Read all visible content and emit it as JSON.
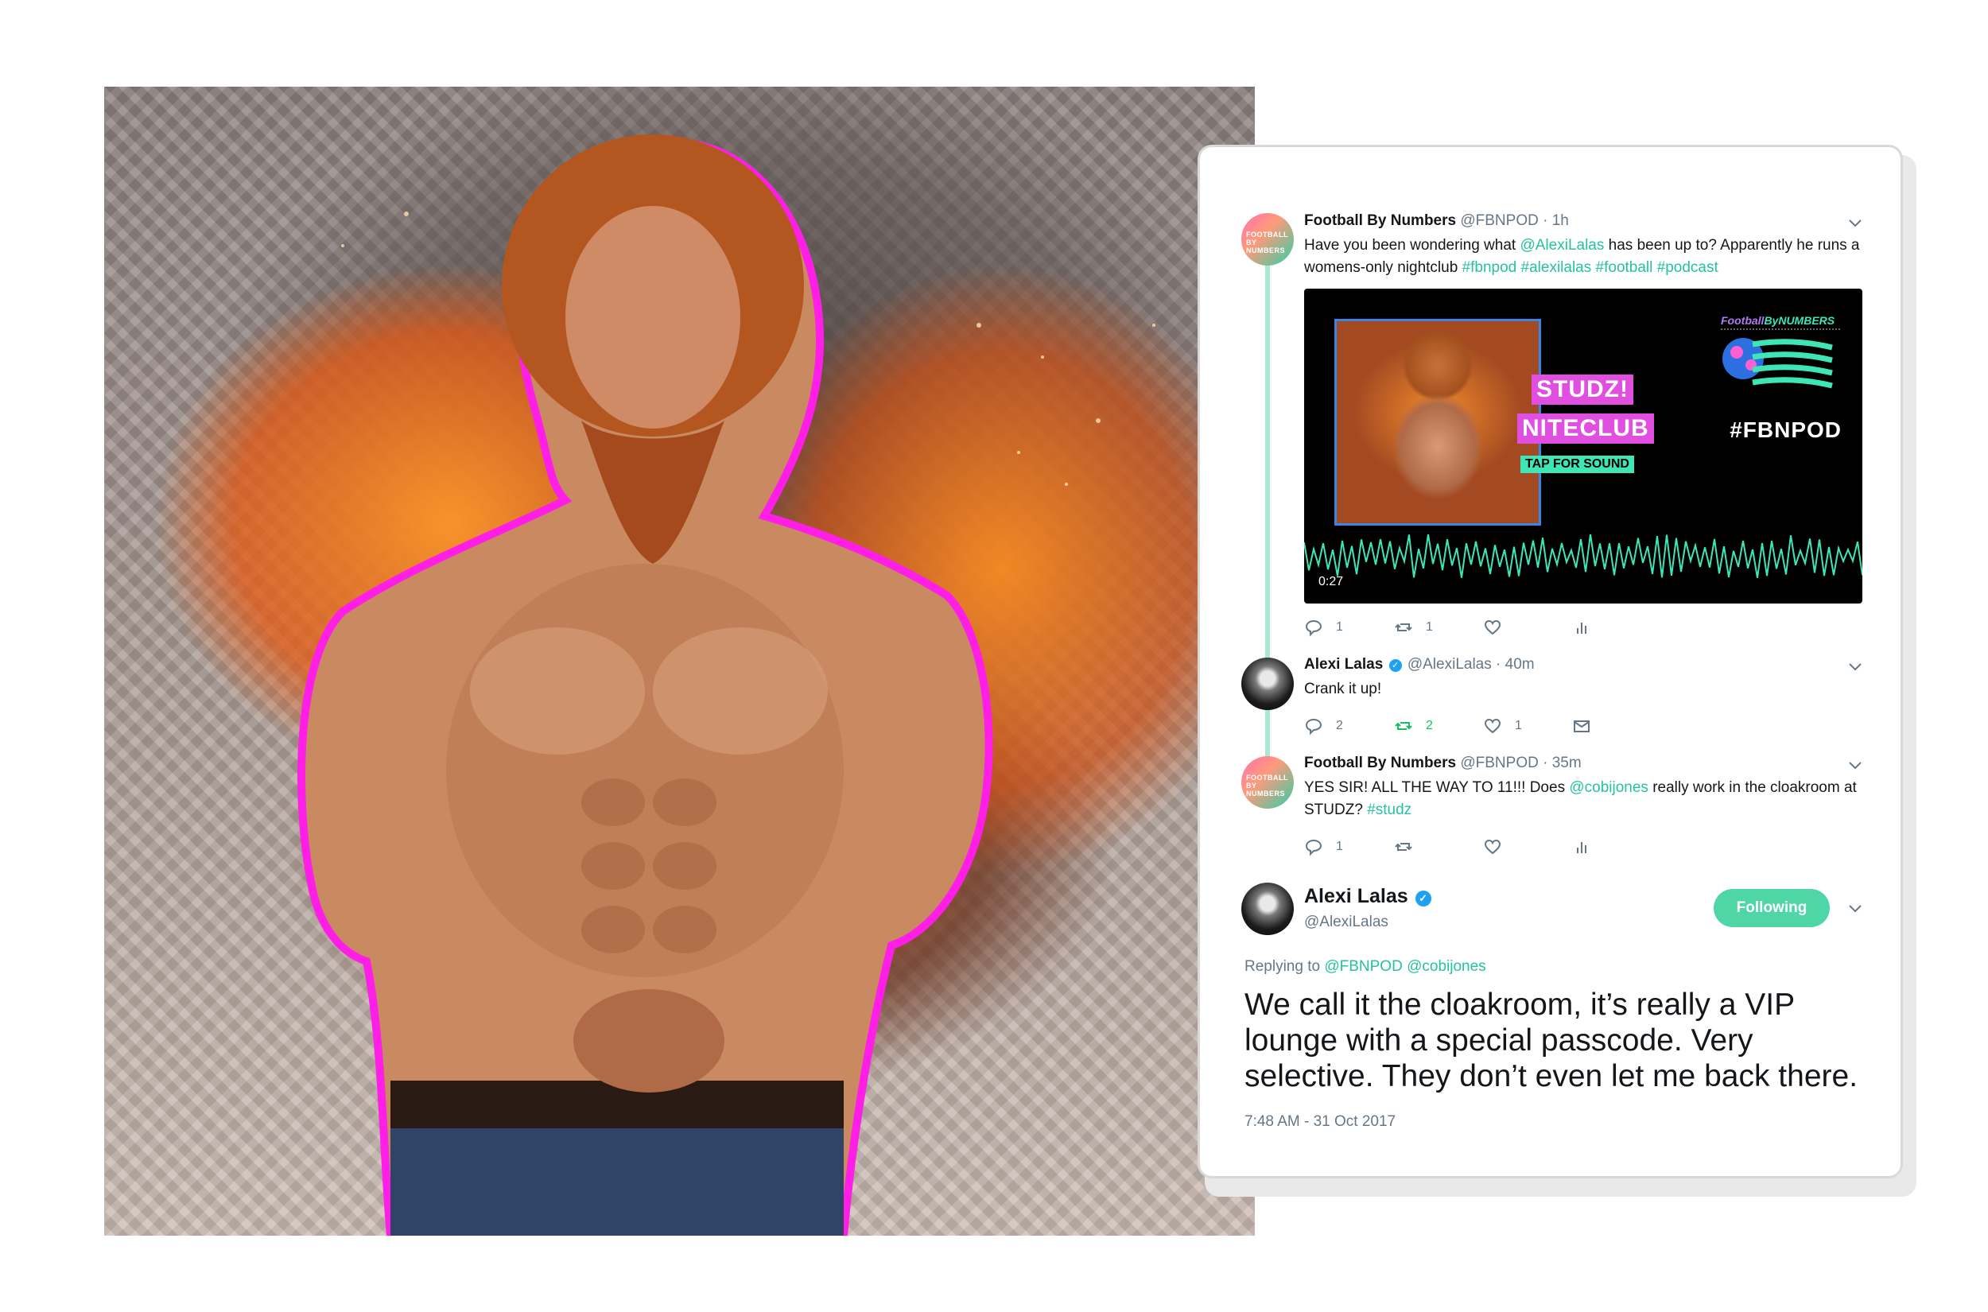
{
  "tweets": [
    {
      "name": "Football By Numbers",
      "handle": "@FBNPOD",
      "time": "· 1h",
      "avatar_text": "FOOTBALL BY NUMBERS",
      "text_parts": [
        "Have you been wondering what ",
        "@AlexiLalas",
        " has been up to? Apparently he runs a womens-only nightclub ",
        "#fbnpod",
        " ",
        "#alexilalas",
        " ",
        "#football",
        " ",
        "#podcast"
      ],
      "replies": "1",
      "retweets": "1"
    },
    {
      "name": "Alexi Lalas",
      "handle": "@AlexiLalas",
      "time": "· 40m",
      "text": "Crank it up!",
      "replies": "2",
      "retweets": "2",
      "likes": "1"
    },
    {
      "name": "Football By Numbers",
      "handle": "@FBNPOD",
      "time": "· 35m",
      "avatar_text": "FOOTBALL BY NUMBERS",
      "text_parts": [
        "YES SIR! ALL THE WAY TO 11!!! Does ",
        "@cobijones",
        " really work in the cloakroom at STUDZ? ",
        "#studz"
      ],
      "replies": "1"
    }
  ],
  "media": {
    "studz": "STUDZ!",
    "niteclub": "NITECLUB",
    "tap": "TAP FOR SOUND",
    "brand_a": "Football",
    "brand_b": "ByNUMBERS",
    "hashtag": "#FBNPOD",
    "timecode": "0:27"
  },
  "main_tweet": {
    "name": "Alexi Lalas",
    "handle": "@AlexiLalas",
    "follow_label": "Following",
    "replying_prefix": "Replying to ",
    "replying_to": "@FBNPOD @cobijones",
    "text": "We call it the cloakroom, it’s really a VIP lounge with a special passcode. Very selective. They don’t even let me back there.",
    "timestamp": "7:48 AM - 31 Oct 2017"
  },
  "colors": {
    "accent_green": "#25c2a0",
    "follow_button": "#4fd6a6",
    "neon_outline": "#ff1ee6",
    "studz_pink": "#e04fe0"
  }
}
